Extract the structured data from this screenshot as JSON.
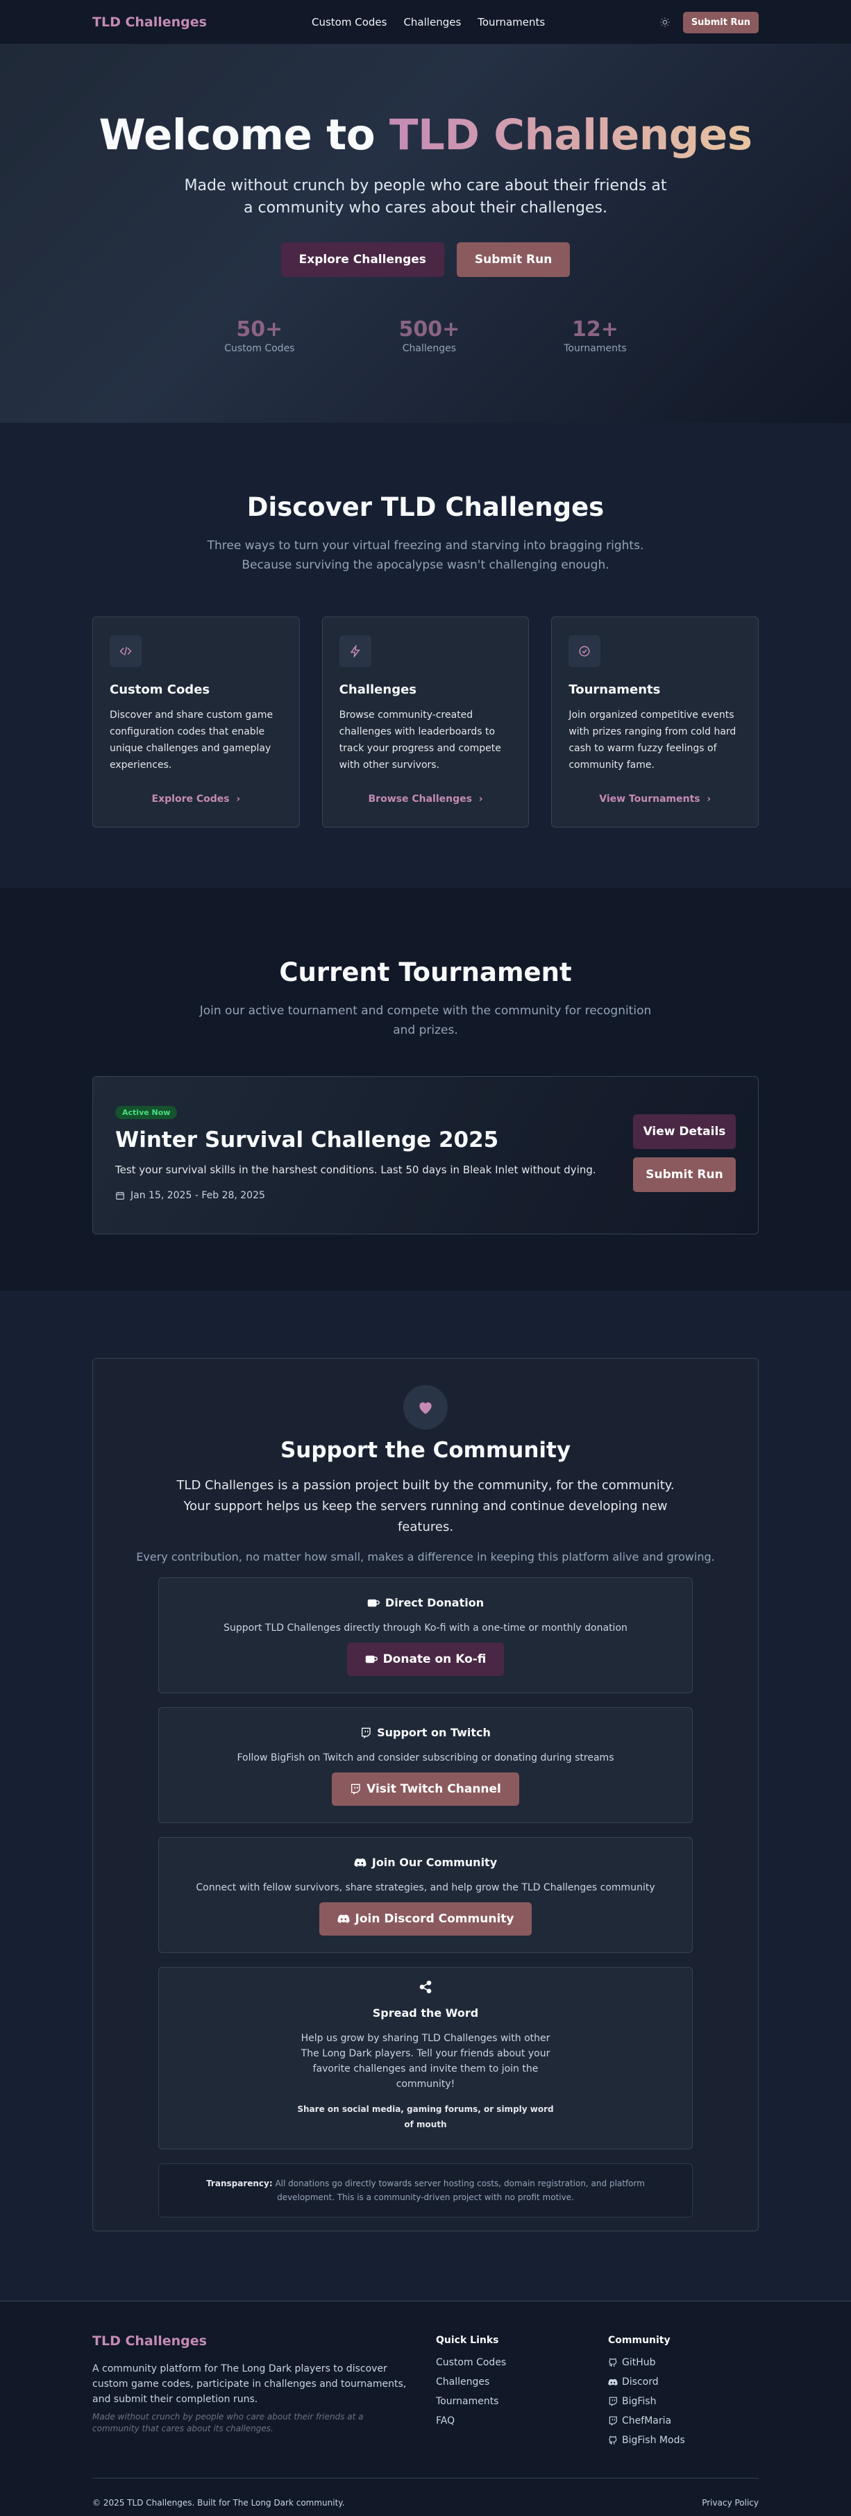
{
  "nav": {
    "brand": "TLD Challenges",
    "links": [
      "Custom Codes",
      "Challenges",
      "Tournaments"
    ],
    "theme_icon": "sun-icon",
    "submit": "Submit Run"
  },
  "hero": {
    "title_plain": "Welcome to ",
    "title_accent": "TLD Challenges",
    "subtitle": "Made without crunch by people who care about their friends at a community who cares about their challenges.",
    "btn_explore": "Explore Challenges",
    "btn_submit": "Submit Run",
    "stats": [
      {
        "num": "50+",
        "label": "Custom Codes"
      },
      {
        "num": "500+",
        "label": "Challenges"
      },
      {
        "num": "12+",
        "label": "Tournaments"
      }
    ]
  },
  "discover": {
    "title": "Discover TLD Challenges",
    "subtitle": "Three ways to turn your virtual freezing and starving into bragging rights. Because surviving the apocalypse wasn't challenging enough.",
    "cards": [
      {
        "icon": "code-icon",
        "title": "Custom Codes",
        "text": "Discover and share custom game configuration codes that enable unique challenges and gameplay experiences.",
        "link": "Explore Codes"
      },
      {
        "icon": "lightning-icon",
        "title": "Challenges",
        "text": "Browse community-created challenges with leaderboards to track your progress and compete with other survivors.",
        "link": "Browse Challenges"
      },
      {
        "icon": "check-circle-icon",
        "title": "Tournaments",
        "text": "Join organized competitive events with prizes ranging from cold hard cash to warm fuzzy feelings of community fame.",
        "link": "View Tournaments"
      }
    ]
  },
  "tournament": {
    "title": "Current Tournament",
    "subtitle": "Join our active tournament and compete with the community for recognition and prizes.",
    "badge": "Active Now",
    "name": "Winter Survival Challenge 2025",
    "description": "Test your survival skills in the harshest conditions. Last 50 days in Bleak Inlet without dying.",
    "dates": "Jan 15, 2025 - Feb 28, 2025",
    "btn_details": "View Details",
    "btn_submit": "Submit Run"
  },
  "support": {
    "title": "Support the Community",
    "lead": "TLD Challenges is a passion project built by the community, for the community. Your support helps us keep the servers running and continue developing new features.",
    "lead2": "Every contribution, no matter how small, makes a difference in keeping this platform alive and growing.",
    "donation": {
      "title": "Direct Donation",
      "text": "Support TLD Challenges directly through Ko-fi with a one-time or monthly donation",
      "btn": "Donate on Ko-fi"
    },
    "twitch": {
      "title": "Support on Twitch",
      "text": "Follow BigFish on Twitch and consider subscribing or donating during streams",
      "btn": "Visit Twitch Channel"
    },
    "discord": {
      "title": "Join Our Community",
      "text": "Connect with fellow survivors, share strategies, and help grow the TLD Challenges community",
      "btn": "Join Discord Community"
    },
    "share": {
      "title": "Spread the Word",
      "text": "Help us grow by sharing TLD Challenges with other The Long Dark players. Tell your friends about your favorite challenges and invite them to join the community!",
      "strong": "Share on social media, gaming forums, or simply word of mouth"
    },
    "transparency_label": "Transparency:",
    "transparency_text": " All donations go directly towards server hosting costs, domain registration, and platform development. This is a community-driven project with no profit motive."
  },
  "footer": {
    "brand": "TLD Challenges",
    "desc": "A community platform for The Long Dark players to discover custom game codes, participate in challenges and tournaments, and submit their completion runs.",
    "note": "Made without crunch by people who care about their friends at a community that cares about its challenges.",
    "quick_title": "Quick Links",
    "quick_links": [
      "Custom Codes",
      "Challenges",
      "Tournaments",
      "FAQ"
    ],
    "community_title": "Community",
    "community_links": [
      {
        "icon": "github-icon",
        "label": "GitHub"
      },
      {
        "icon": "discord-icon",
        "label": "Discord"
      },
      {
        "icon": "twitch-icon",
        "label": "BigFish"
      },
      {
        "icon": "twitch-icon",
        "label": "ChefMaria"
      },
      {
        "icon": "github-icon",
        "label": "BigFish Mods"
      }
    ],
    "copyright": "© 2025 TLD Challenges. Built for The Long Dark community.",
    "privacy": "Privacy Policy"
  },
  "colors": {
    "accent": "#c58bb5",
    "purple_btn": "#4a2745",
    "rose_btn": "#8b5a5e",
    "bg": "#0f172a"
  }
}
